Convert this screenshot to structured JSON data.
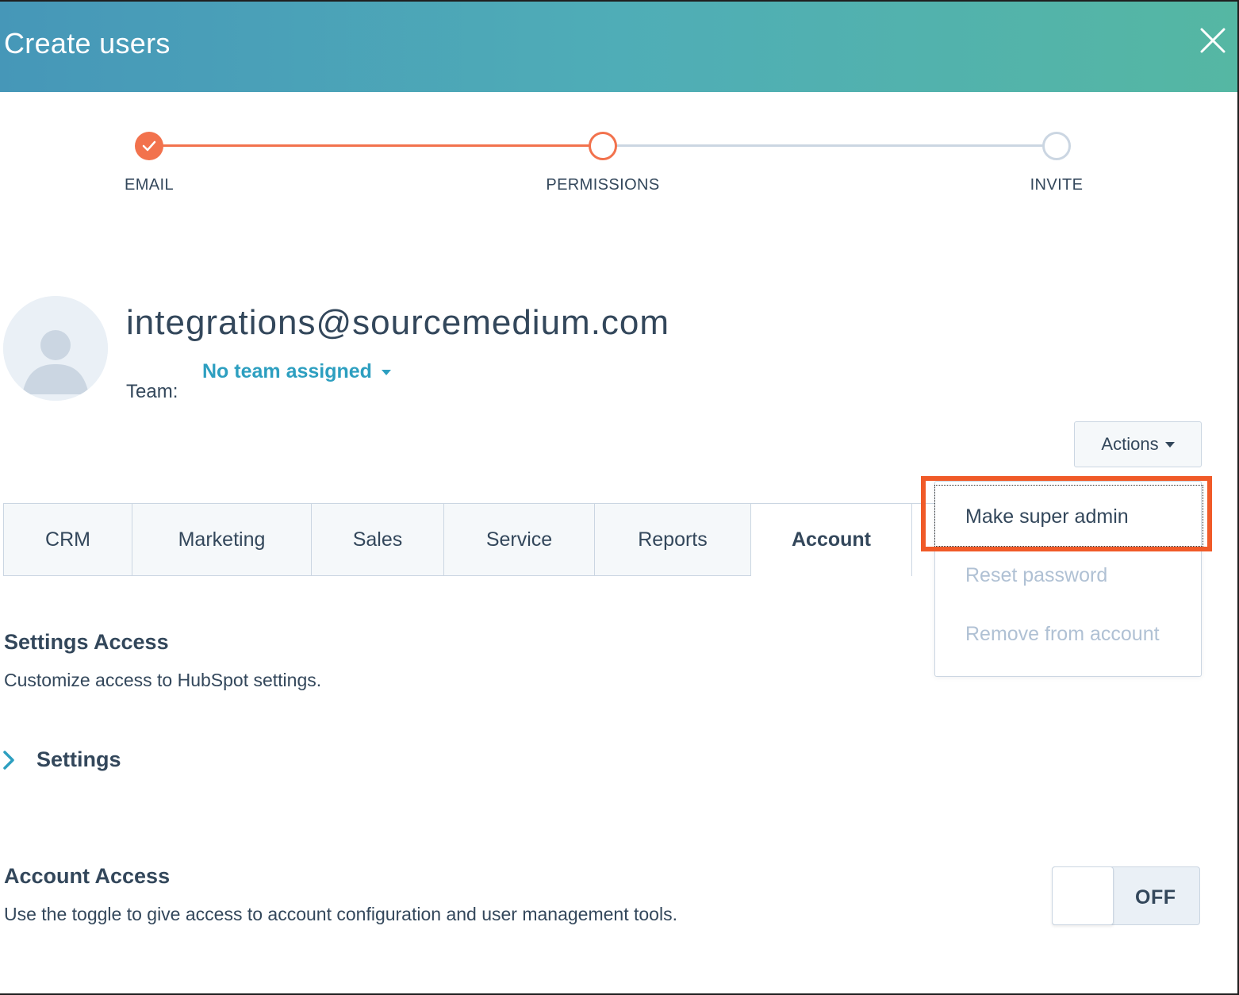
{
  "modal": {
    "title": "Create users"
  },
  "stepper": {
    "steps": [
      {
        "label": "EMAIL",
        "state": "complete"
      },
      {
        "label": "PERMISSIONS",
        "state": "active"
      },
      {
        "label": "INVITE",
        "state": "pending"
      }
    ]
  },
  "user": {
    "email": "integrations@sourcemedium.com",
    "team_label": "Team:",
    "team_value": "No team assigned"
  },
  "actions": {
    "label": "Actions",
    "menu": [
      {
        "label": "Make super admin",
        "enabled": true
      },
      {
        "label": "Reset password",
        "enabled": false
      },
      {
        "label": "Remove from account",
        "enabled": false
      }
    ]
  },
  "tabs": [
    {
      "label": "CRM"
    },
    {
      "label": "Marketing"
    },
    {
      "label": "Sales"
    },
    {
      "label": "Service"
    },
    {
      "label": "Reports"
    },
    {
      "label": "Account"
    }
  ],
  "active_tab": "Account",
  "settings_access": {
    "title": "Settings Access",
    "description": "Customize access to HubSpot settings.",
    "expander_label": "Settings"
  },
  "account_access": {
    "title": "Account Access",
    "description": "Use the toggle to give access to account configuration and user management tools.",
    "toggle_label": "OFF"
  },
  "colors": {
    "header_start": "#4697b8",
    "header_end": "#55b7a3",
    "accent_orange": "#f2724d",
    "highlight": "#f05a28",
    "link_blue": "#2d9fc0",
    "text": "#33475b",
    "disabled_text": "#b0c1d4"
  }
}
